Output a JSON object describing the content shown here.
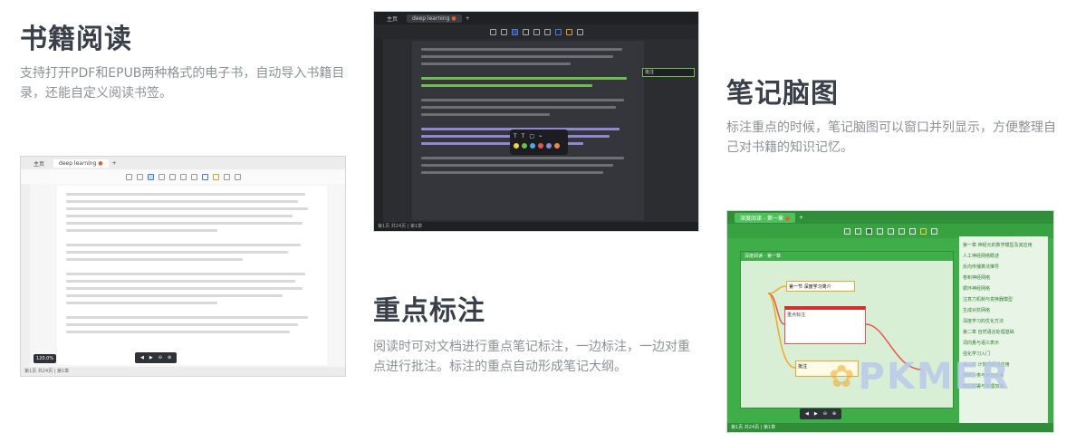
{
  "features": {
    "reading": {
      "title": "书籍阅读",
      "desc": "支持打开PDF和EPUB两种格式的电子书，自动导入书籍目录，还能自定义阅读书签。"
    },
    "highlight": {
      "title": "重点标注",
      "desc": "阅读时可对文档进行重点笔记标注，一边标注，一边对重点进行批注。标注的重点自动形成笔记大纲。"
    },
    "mindmap": {
      "title": "笔记脑图",
      "desc": "标注重点的时候，笔记脑图可以窗口并列显示，方便整理自己对书籍的知识记忆。"
    }
  },
  "shots": {
    "reading": {
      "tab_home": "主页",
      "tab_doc": "deep learning",
      "status": "第1页 共24页 | 第1章",
      "zoom": "120.0%"
    },
    "highlight": {
      "tab_home": "主页",
      "tab_doc": "deep learning",
      "comment": "批注",
      "status": "第1页 共24页 | 第1章"
    },
    "mindmap": {
      "tab_doc": "深度阅读 - 第一章",
      "node1": "第一节 深度学习简介",
      "node2": "重点标注",
      "node3": "批注",
      "outline": [
        "第一章 神经元的数学模型及其应用",
        "人工神经网络概述",
        "反向传播算法推导",
        "卷积神经网络",
        "循环神经网络",
        "注意力机制与变换器模型",
        "生成对抗网络",
        "深度学习的优化方法",
        "第二章 自然语言处理基础",
        "词向量与语义表示",
        "强化学习入门",
        "第三章 计算机视觉应用",
        "图像分类与目标检测",
        "模型部署与推理加速"
      ],
      "status": "第1页 共24页 | 第1章"
    }
  },
  "watermark": "PKMER",
  "colors": {
    "title": "#3a3f4a",
    "desc": "#8d9097",
    "highlight_green": "#6cc04a",
    "annotation_purple": "#8f87d6",
    "mindmap_green": "#3fae49",
    "watermark": "#b9c9ea"
  }
}
